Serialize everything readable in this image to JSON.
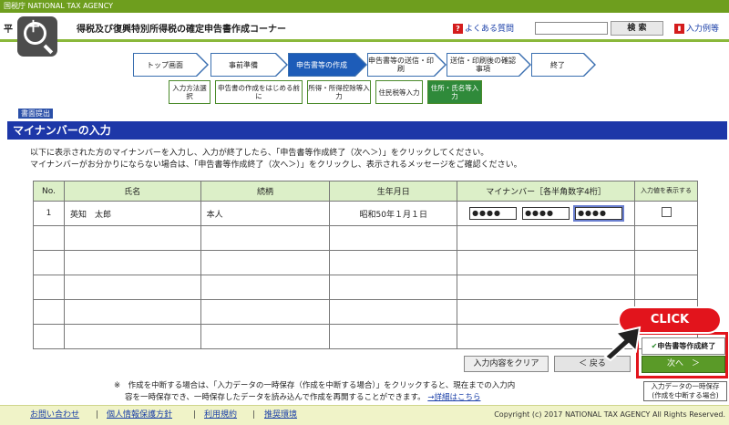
{
  "header": {
    "agency": "国税庁 NATIONAL TAX AGENCY",
    "title_prefix": "平",
    "title_suffix": "得税及び復興特別所得税の確定申告書作成コーナー",
    "faq": "よくある質問",
    "search_button": "検 索",
    "help": "入力例等"
  },
  "steps": [
    "トップ画面",
    "事前準備",
    "申告書等の作成",
    "申告書等の送信・印刷",
    "送信・印刷後の確認事項",
    "終了"
  ],
  "substeps": [
    "入力方法選択",
    "申告書の作成をはじめる前に",
    "所得・所得控除等入力",
    "住民税等入力",
    "住所・氏名等入力"
  ],
  "screen_tag": "書面提出",
  "section_title": "マイナンバーの入力",
  "instructions": [
    "以下に表示された方のマイナンバーを入力し、入力が終了したら、「申告書等作成終了（次へ＞）」をクリックしてください。",
    "マイナンバーがお分かりにならない場合は、「申告書等作成終了（次へ＞）」をクリックし、表示されるメッセージをご確認ください。"
  ],
  "table": {
    "headers": [
      "No.",
      "氏名",
      "続柄",
      "生年月日",
      "マイナンバー［各半角数字4桁］",
      "入力値を表示する"
    ],
    "rows": [
      {
        "no": "1",
        "name": "英知　太郎",
        "relation": "本人",
        "dob": "昭和50年１月１日",
        "mn1": "●●●●",
        "mn2": "●●●●",
        "mn3": "●●●●"
      }
    ]
  },
  "buttons": {
    "clear": "入力内容をクリア",
    "back": "＜ 戻る",
    "finish": "申告書等作成終了",
    "next": "次へ　＞",
    "save_line1": "入力データの一時保存",
    "save_line2": "(作成を中断する場合)"
  },
  "click_badge": "CLICK",
  "note": {
    "line1": "※　作成を中断する場合は、「入力データの一時保存（作成を中断する場合）」をクリックすると、現在までの入力内",
    "line2": "容を一時保存でき、一時保存したデータを読み込んで作成を再開することができます。",
    "detail_link": "→詳細はこちら"
  },
  "footer": {
    "links": [
      "お問い合わせ",
      "個人情報保護方針",
      "利用規約",
      "推奨環境"
    ],
    "separator": "|",
    "copyright": "Copyright (c) 2017 NATIONAL TAX AGENCY All Rights Reserved."
  },
  "colors": {
    "agency_green": "#6e9e1e",
    "section_blue": "#1d37a8",
    "active_step": "#1d5cb8",
    "active_substep": "#2f8a3a",
    "click_red": "#e2141c",
    "next_green": "#5a9a28"
  }
}
